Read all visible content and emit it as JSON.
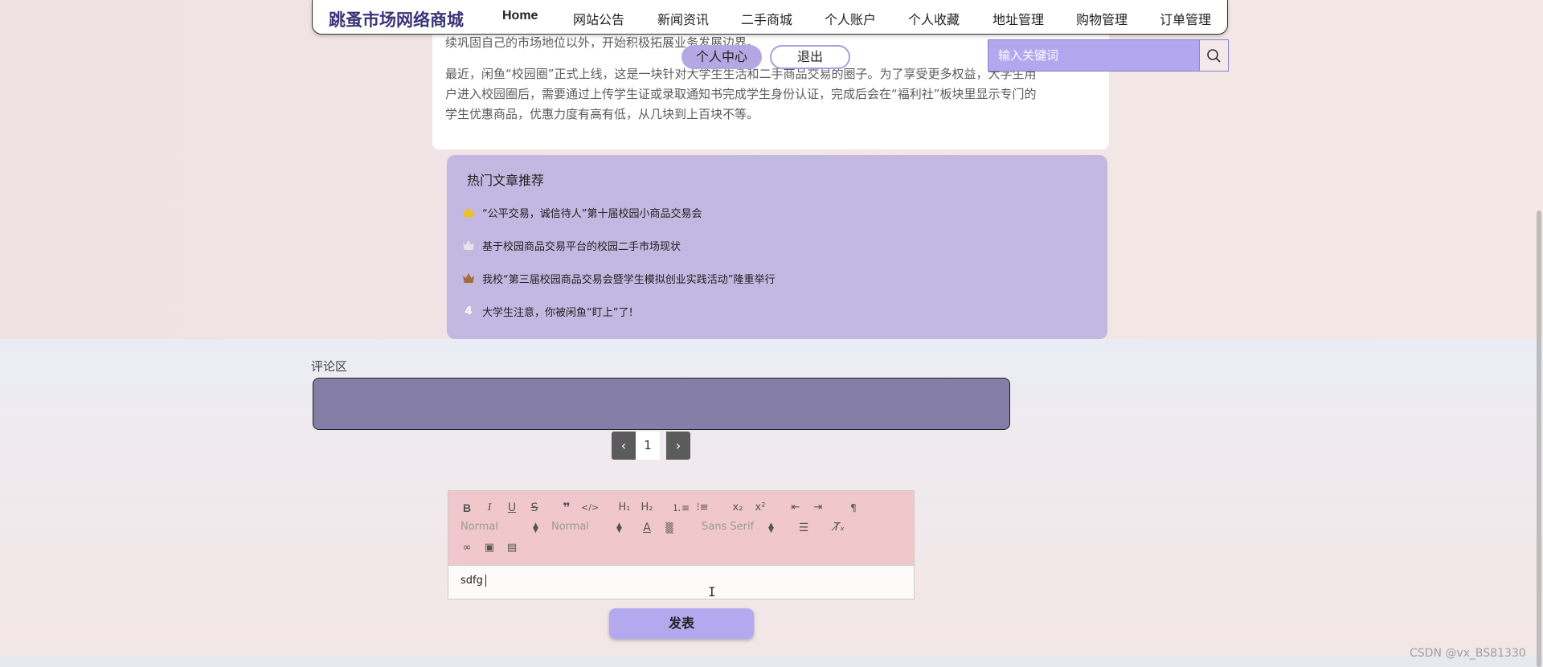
{
  "nav": {
    "brand": "跳蚤市场网络商城",
    "items": [
      "Home",
      "网站公告",
      "新闻资讯",
      "二手商城",
      "个人账户",
      "个人收藏",
      "地址管理",
      "购物管理",
      "订单管理"
    ]
  },
  "article": {
    "line_top": "续巩固自己的市场地位以外，开始积极拓展业务发展边界。",
    "paragraph": [
      "最近，闲鱼“校园圈”正式上线，这是一块针对大学生生活和二手商品交易的圈子。为了享受更多权益，大学生用",
      "户进入校园圈后，需要通过上传学生证或录取通知书完成学生身份认证，完成后会在“福利社”板块里显示专门的",
      "学生优惠商品，优惠力度有高有低，从几块到上百块不等。"
    ]
  },
  "user_menu": {
    "center": "个人中心",
    "logout": "退出"
  },
  "search": {
    "placeholder": "输入关键词"
  },
  "hot": {
    "title": "热门文章推荐",
    "items": [
      {
        "rank": "gold-crown",
        "title": "“公平交易，诚信待人”第十届校园小商品交易会"
      },
      {
        "rank": "silver-crown",
        "title": "基于校园商品交易平台的校园二手市场现状"
      },
      {
        "rank": "bronze-crown",
        "title": "我校“第三届校园商品交易会暨学生模拟创业实践活动”隆重举行"
      },
      {
        "rank": "4",
        "title": "大学生注意，你被闲鱼“盯上”了!"
      }
    ]
  },
  "comments": {
    "label": "评论区"
  },
  "pager": {
    "prev": "‹",
    "current": "1",
    "next": "›"
  },
  "editor": {
    "selects": {
      "header": "Normal",
      "size": "Normal",
      "font": "Sans Serif"
    },
    "content": "sdfg"
  },
  "submit_label": "发表",
  "watermark": "CSDN @vx_BS81330",
  "colors": {
    "accent": "#b4a8ef",
    "hot_bg": "#c3b8e1",
    "comment_bg": "#857ea6",
    "toolbar_bg": "#f0c8cb",
    "brand": "#3a3578"
  }
}
